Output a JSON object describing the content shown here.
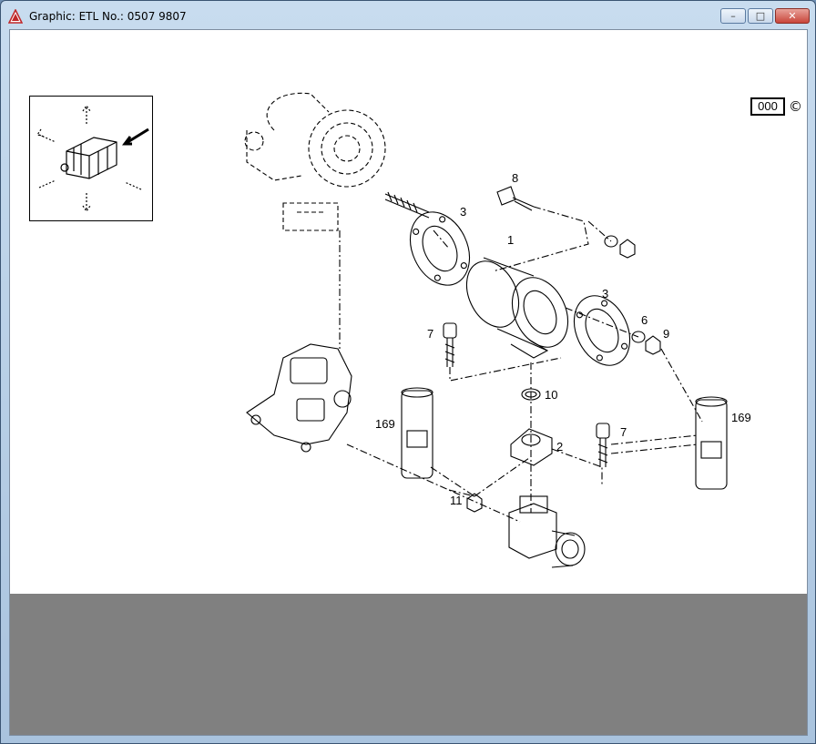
{
  "window": {
    "title": "Graphic: ETL No.: 0507 9807",
    "controls": {
      "minimize": "–",
      "maximize": "□",
      "close": "✕"
    }
  },
  "badge": {
    "box_text": "000",
    "copyright": "©"
  },
  "callouts": {
    "c1": "1",
    "c2": "2",
    "c3a": "3",
    "c3b": "3",
    "c6": "6",
    "c7a": "7",
    "c7b": "7",
    "c8": "8",
    "c9": "9",
    "c10": "10",
    "c11": "11",
    "c169a": "169",
    "c169b": "169"
  },
  "icons": [
    "app-warning-icon",
    "minimize-icon",
    "maximize-icon",
    "close-icon"
  ]
}
